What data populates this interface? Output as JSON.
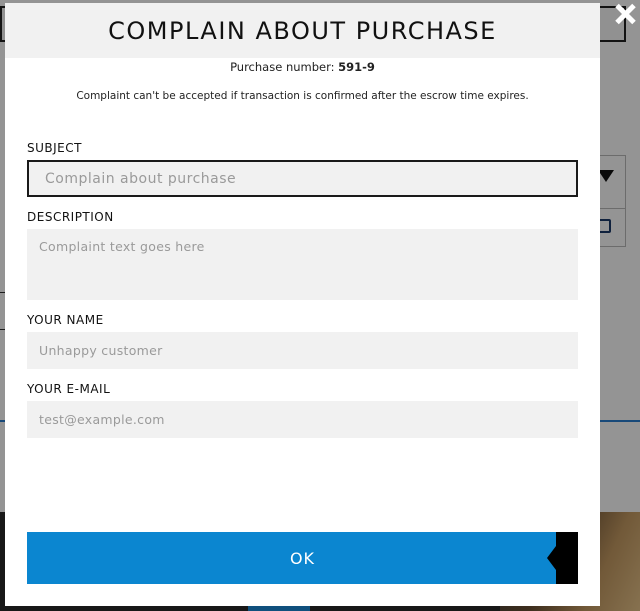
{
  "modal": {
    "title": "COMPLAIN ABOUT PURCHASE",
    "purchase_label": "Purchase number:",
    "purchase_number": "591-9",
    "notice": "Complaint can't be accepted if transaction is confirmed after the escrow time expires."
  },
  "form": {
    "subject": {
      "label": "SUBJECT",
      "placeholder": "Complain about purchase",
      "value": ""
    },
    "description": {
      "label": "DESCRIPTION",
      "placeholder": "Complaint text goes here",
      "value": ""
    },
    "name": {
      "label": "YOUR NAME",
      "placeholder": "Unhappy customer",
      "value": ""
    },
    "email": {
      "label": "YOUR E-MAIL",
      "placeholder": "test@example.com",
      "value": ""
    }
  },
  "actions": {
    "ok_label": "OK"
  },
  "icons": {
    "close": "close-icon",
    "filter": "filter-icon",
    "contact": "contact-card-icon"
  },
  "colors": {
    "accent": "#0b86d0",
    "header_bg": "#f1f1f1",
    "field_bg": "#f1f1f1",
    "overlay": "rgba(0,0,0,0.42)"
  }
}
